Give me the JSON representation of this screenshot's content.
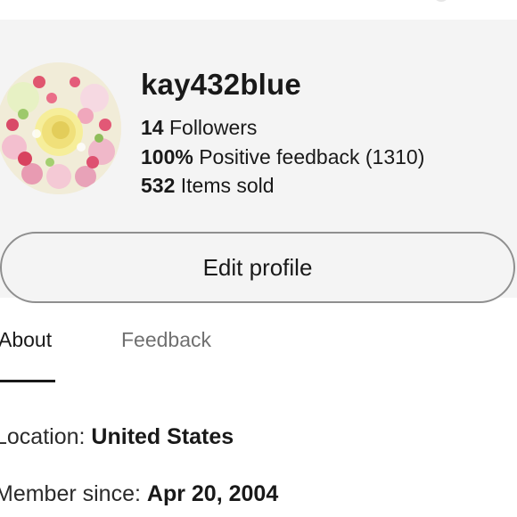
{
  "profile": {
    "username": "kay432blue",
    "followers_count": "14",
    "followers_label": "Followers",
    "feedback_percent": "100%",
    "feedback_label": "Positive feedback (1310)",
    "items_sold_count": "532",
    "items_sold_label": "Items sold",
    "avatar": "flower-bouquet-photo"
  },
  "actions": {
    "edit_profile": "Edit profile"
  },
  "tabs": [
    {
      "label": "About",
      "active": true
    },
    {
      "label": "Feedback",
      "active": false
    }
  ],
  "about": {
    "location_label": "Location:",
    "location_value": "United States",
    "member_since_label": "Member since:",
    "member_since_value": "Apr 20, 2004"
  }
}
